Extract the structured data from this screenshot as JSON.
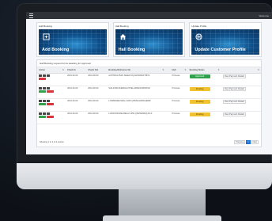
{
  "app": {
    "user_label": "Welcome"
  },
  "cards": [
    {
      "title": "Add Booking",
      "label": "Add Booking",
      "icon": "add-booking-icon"
    },
    {
      "title": "Hall Booking",
      "label": "Hall Booking",
      "icon": "home-icon"
    },
    {
      "title": "Update Profile",
      "label": "Update Customer Profile",
      "icon": "basketball-icon"
    }
  ],
  "bookings": {
    "title": "Hall Booking request forms awaiting for approval",
    "columns": [
      "Action",
      "",
      "Check In",
      "Check Out",
      "Booking Reference No",
      "",
      "Hall",
      "Booking Status",
      ""
    ],
    "rows": [
      {
        "check_in": "2019-00-00",
        "check_out": "2019-00-00",
        "ref": "AUSTRALI BAN SHELFUQ AHKIMADIYBOS",
        "hall": "Princess",
        "status": "Approved",
        "view": "View Payment Details"
      },
      {
        "check_in": "2019-00-00",
        "check_out": "2019-00-00",
        "ref": "SIALFORLDUERHAUTFELHIMANCIWNDSD",
        "hall": "Princess",
        "status": "Pending",
        "view": "View Payment Details"
      },
      {
        "check_in": "2019-00-00",
        "check_out": "2019-00-00",
        "ref": "LOWRENEUSEAU LRW QSMSAHDSKAEMR",
        "hall": "Princess",
        "status": "Pending",
        "view": "View Payment Details"
      },
      {
        "check_in": "2019-00-00",
        "check_out": "2019-00-00",
        "ref": "LUKWIOSUREUSEAU LRW QSMSAMDQJCLF",
        "hall": "Princess",
        "status": "Pending",
        "view": "View Payment Details"
      }
    ],
    "footer_info": "Showing 1 to 4 of 4 entries",
    "pager": {
      "prev": "Previous",
      "page": "1",
      "next": "Next"
    }
  },
  "colors": {
    "approved": "#31a24c",
    "pending": "#f2c12e",
    "accent": "#1d72d6"
  }
}
